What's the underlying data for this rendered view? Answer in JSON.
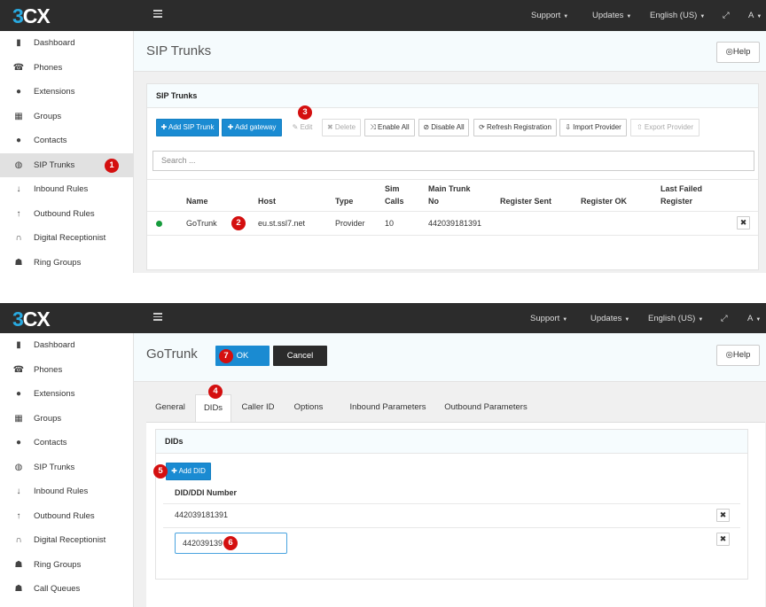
{
  "topbar": {
    "logo_prefix": "3",
    "logo_suffix": "CX",
    "support": "Support",
    "updates": "Updates",
    "language": "English (US)",
    "account": "A"
  },
  "sidebar": {
    "dashboard": "Dashboard",
    "phones": "Phones",
    "extensions": "Extensions",
    "groups": "Groups",
    "contacts": "Contacts",
    "sip_trunks": "SIP Trunks",
    "inbound_rules": "Inbound Rules",
    "outbound_rules": "Outbound Rules",
    "digital_receptionist": "Digital Receptionist",
    "ring_groups": "Ring Groups",
    "call_queues": "Call Queues"
  },
  "trunks_page": {
    "title": "SIP Trunks",
    "help": "Help",
    "card_title": "SIP Trunks",
    "toolbar": {
      "add_sip_trunk": "Add SIP Trunk",
      "add_gateway": "Add gateway",
      "edit": "Edit",
      "delete": "Delete",
      "enable_all": "Enable All",
      "disable_all": "Disable All",
      "refresh_registration": "Refresh Registration",
      "import_provider": "Import Provider",
      "export_provider": "Export Provider"
    },
    "search_placeholder": "Search ...",
    "columns": {
      "name": "Name",
      "host": "Host",
      "type": "Type",
      "sim_calls_1": "Sim",
      "sim_calls_2": "Calls",
      "main_trunk_1": "Main Trunk",
      "main_trunk_2": "No",
      "register_sent": "Register Sent",
      "register_ok": "Register OK",
      "last_failed_1": "Last Failed",
      "last_failed_2": "Register"
    },
    "row": {
      "name": "GoTrunk",
      "host": "eu.st.ssl7.net",
      "type": "Provider",
      "sim_calls": "10",
      "main_trunk_no": "442039181391",
      "status_color": "#169b3c"
    }
  },
  "edit_page": {
    "title": "GoTrunk",
    "ok": "OK",
    "cancel": "Cancel",
    "help": "Help",
    "tabs": {
      "general": "General",
      "dids": "DIDs",
      "caller_id": "Caller ID",
      "options": "Options",
      "inbound_parameters": "Inbound Parameters",
      "outbound_parameters": "Outbound Parameters"
    },
    "card_title": "DIDs",
    "add_did": "Add DID",
    "did_column": "DID/DDI Number",
    "did_rows": [
      "442039181391"
    ],
    "did_input_value": "442039139"
  },
  "annotations": {
    "b1": "1",
    "b2": "2",
    "b3": "3",
    "b4": "4",
    "b5": "5",
    "b6": "6",
    "b7": "7"
  },
  "colors": {
    "accent_blue": "#1a8bd2",
    "badge_red": "#d40f0f",
    "topbar": "#2c2c2c"
  }
}
